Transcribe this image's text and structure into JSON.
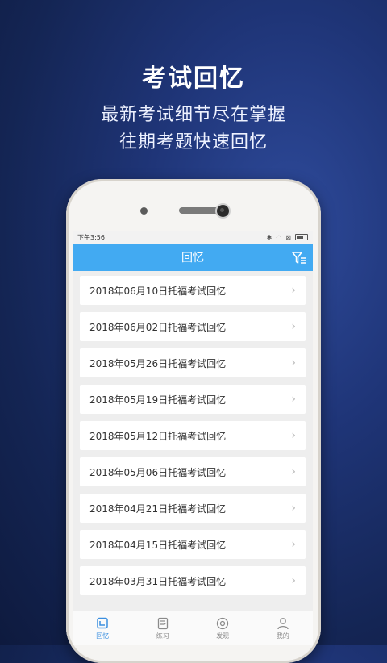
{
  "promo": {
    "headline": "考试回忆",
    "line1": "最新考试细节尽在掌握",
    "line2": "往期考题快速回忆"
  },
  "status": {
    "time": "下午3:56"
  },
  "appbar": {
    "title": "回忆"
  },
  "list": {
    "items": [
      "2018年06月10日托福考试回忆",
      "2018年06月02日托福考试回忆",
      "2018年05月26日托福考试回忆",
      "2018年05月19日托福考试回忆",
      "2018年05月12日托福考试回忆",
      "2018年05月06日托福考试回忆",
      "2018年04月21日托福考试回忆",
      "2018年04月15日托福考试回忆",
      "2018年03月31日托福考试回忆"
    ]
  },
  "tabs": [
    {
      "label": "回忆",
      "icon": "recall-icon",
      "active": true
    },
    {
      "label": "练习",
      "icon": "practice-icon",
      "active": false
    },
    {
      "label": "发现",
      "icon": "discover-icon",
      "active": false
    },
    {
      "label": "我的",
      "icon": "profile-icon",
      "active": false
    }
  ],
  "colors": {
    "accent": "#42aaf2",
    "tab_active": "#3b8fe0"
  }
}
